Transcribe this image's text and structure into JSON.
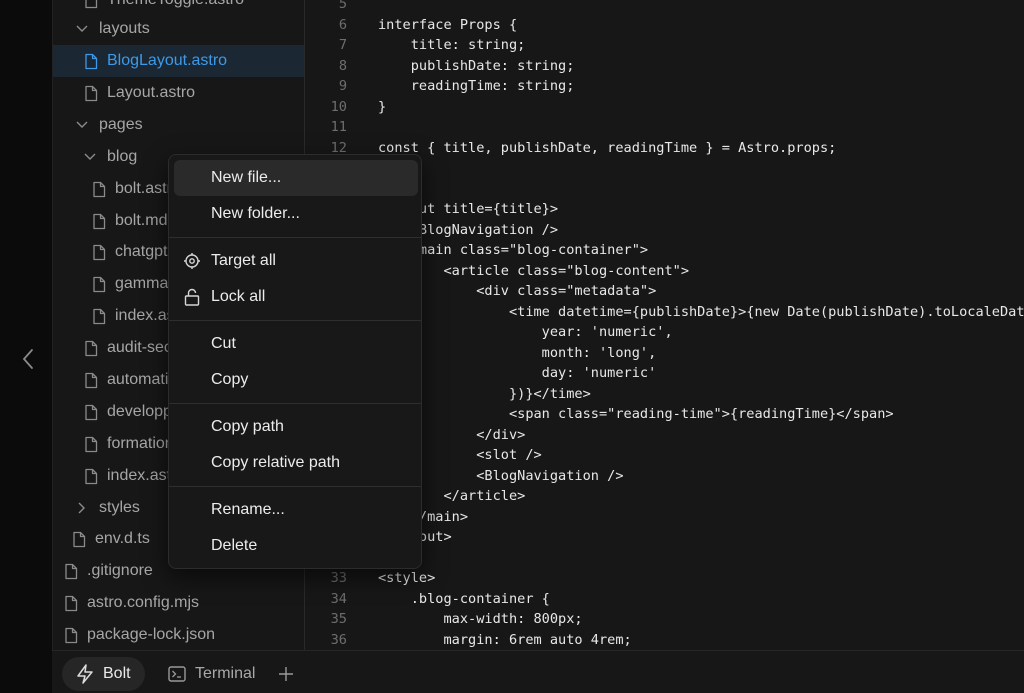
{
  "sidebar": {
    "collapse_icon": "chevron-left-icon"
  },
  "file_tree": {
    "rows": [
      {
        "label": "ThemeToggle.astro",
        "type": "file",
        "depth": 2
      },
      {
        "label": "layouts",
        "type": "folder-open",
        "depth": 1
      },
      {
        "label": "BlogLayout.astro",
        "type": "file",
        "depth": 2,
        "selected": true
      },
      {
        "label": "Layout.astro",
        "type": "file",
        "depth": 2
      },
      {
        "label": "pages",
        "type": "folder-open",
        "depth": 1
      },
      {
        "label": "blog",
        "type": "folder-open",
        "depth": 2
      },
      {
        "label": "bolt.astro",
        "type": "file",
        "depth": 3
      },
      {
        "label": "bolt.md",
        "type": "file",
        "depth": 3
      },
      {
        "label": "chatgpt",
        "type": "file",
        "depth": 3
      },
      {
        "label": "gamma",
        "type": "file",
        "depth": 3
      },
      {
        "label": "index.astro",
        "type": "file",
        "depth": 3
      },
      {
        "label": "audit-sec",
        "type": "file",
        "depth": 2
      },
      {
        "label": "automati",
        "type": "file",
        "depth": 2
      },
      {
        "label": "developp",
        "type": "file",
        "depth": 2
      },
      {
        "label": "formation",
        "type": "file",
        "depth": 2
      },
      {
        "label": "index.astro",
        "type": "file",
        "depth": 2
      },
      {
        "label": "styles",
        "type": "folder-closed",
        "depth": 1
      },
      {
        "label": "env.d.ts",
        "type": "file",
        "depth": 1
      },
      {
        "label": ".gitignore",
        "type": "file",
        "depth": 0
      },
      {
        "label": "astro.config.mjs",
        "type": "file",
        "depth": 0
      },
      {
        "label": "package-lock.json",
        "type": "file",
        "depth": 0
      }
    ]
  },
  "editor": {
    "lines": [
      {
        "n": "5",
        "text": ""
      },
      {
        "n": "6",
        "text": "interface Props {"
      },
      {
        "n": "7",
        "text": "    title: string;"
      },
      {
        "n": "8",
        "text": "    publishDate: string;"
      },
      {
        "n": "9",
        "text": "    readingTime: string;"
      },
      {
        "n": "10",
        "text": "}"
      },
      {
        "n": "11",
        "text": ""
      },
      {
        "n": "12",
        "text": "const { title, publishDate, readingTime } = Astro.props;"
      },
      {
        "n": "",
        "text": ""
      },
      {
        "n": "",
        "text": ""
      },
      {
        "n": "",
        "text": "<Layout title={title}>"
      },
      {
        "n": "",
        "text": "    <BlogNavigation />"
      },
      {
        "n": "",
        "text": "    <main class=\"blog-container\">"
      },
      {
        "n": "",
        "text": "        <article class=\"blog-content\">"
      },
      {
        "n": "",
        "text": "            <div class=\"metadata\">"
      },
      {
        "n": "",
        "text": "                <time datetime={publishDate}>{new Date(publishDate).toLocaleDateString('fr-FR', {"
      },
      {
        "n": "",
        "text": "                    year: 'numeric',"
      },
      {
        "n": "",
        "text": "                    month: 'long',"
      },
      {
        "n": "",
        "text": "                    day: 'numeric'"
      },
      {
        "n": "",
        "text": "                })}</time>"
      },
      {
        "n": "",
        "text": "                <span class=\"reading-time\">{readingTime}</span>"
      },
      {
        "n": "",
        "text": "            </div>"
      },
      {
        "n": "",
        "text": "            <slot />"
      },
      {
        "n": "",
        "text": "            <BlogNavigation />"
      },
      {
        "n": "",
        "text": "        </article>"
      },
      {
        "n": "",
        "text": "    </main>"
      },
      {
        "n": "",
        "text": "</Layout>"
      },
      {
        "n": "",
        "text": ""
      },
      {
        "n": "33",
        "text": "<style>"
      },
      {
        "n": "34",
        "text": "    .blog-container {"
      },
      {
        "n": "35",
        "text": "        max-width: 800px;"
      },
      {
        "n": "36",
        "text": "        margin: 6rem auto 4rem;"
      }
    ]
  },
  "context_menu": {
    "groups": [
      [
        {
          "label": "New file...",
          "icon": null,
          "highlighted": true
        },
        {
          "label": "New folder...",
          "icon": null
        }
      ],
      [
        {
          "label": "Target all",
          "icon": "target-icon"
        },
        {
          "label": "Lock all",
          "icon": "unlock-icon"
        }
      ],
      [
        {
          "label": "Cut",
          "icon": null
        },
        {
          "label": "Copy",
          "icon": null
        }
      ],
      [
        {
          "label": "Copy path",
          "icon": null
        },
        {
          "label": "Copy relative path",
          "icon": null
        }
      ],
      [
        {
          "label": "Rename...",
          "icon": null
        },
        {
          "label": "Delete",
          "icon": null
        }
      ]
    ]
  },
  "bottom_bar": {
    "tabs": [
      {
        "label": "Bolt",
        "icon": "bolt-icon",
        "active": true
      },
      {
        "label": "Terminal",
        "icon": "terminal-icon",
        "active": false
      }
    ],
    "add_tab_icon": "plus-icon"
  },
  "colors": {
    "accent": "#3d9ae8",
    "selected_row_bg": "#1b2733",
    "panel_bg": "#171717",
    "menu_hover_bg": "#2a2a2a"
  }
}
